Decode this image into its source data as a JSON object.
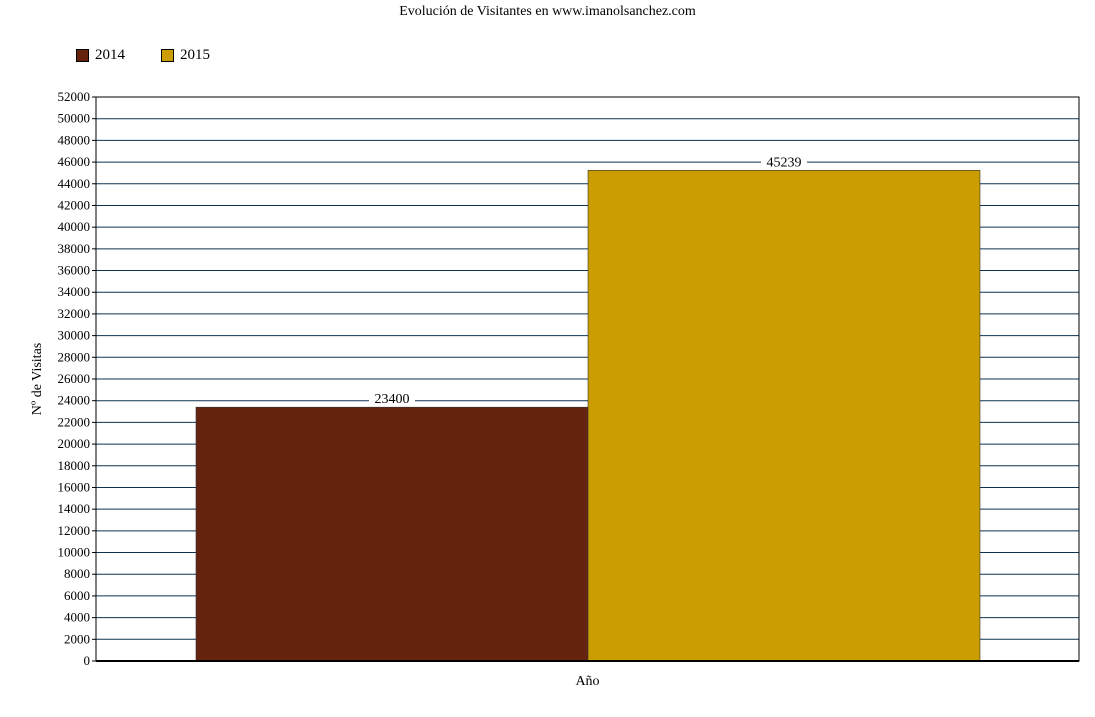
{
  "chart_data": {
    "type": "bar",
    "title": "Evolución de Visitantes en www.imanolsanchez.com",
    "xlabel": "Año",
    "ylabel": "Nº de Visitas",
    "categories": [
      ""
    ],
    "series": [
      {
        "name": "2014",
        "values": [
          23400
        ],
        "color": "#66240f"
      },
      {
        "name": "2015",
        "values": [
          45239
        ],
        "color": "#cc9d00"
      }
    ],
    "ylim": [
      0,
      52000
    ],
    "ytick_step": 2000,
    "grid": true,
    "legend_position": "top-left",
    "data_labels": [
      "23400",
      "45239"
    ]
  }
}
